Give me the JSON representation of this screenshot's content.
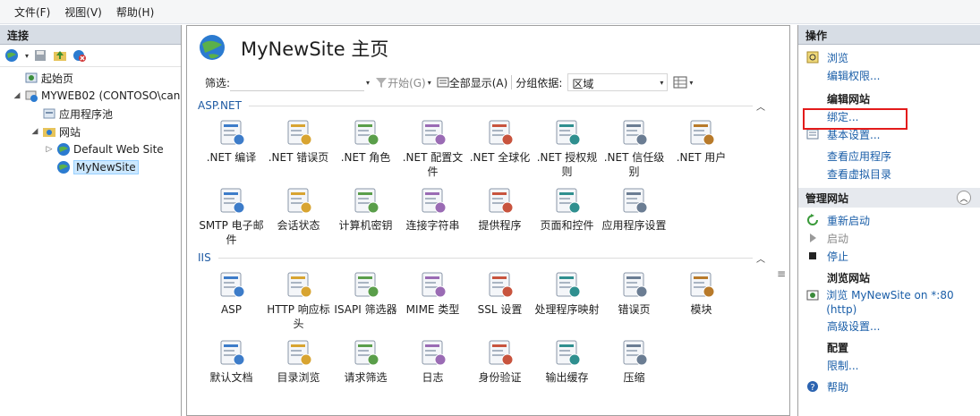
{
  "menu": {
    "file": "文件(F)",
    "view": "视图(V)",
    "help": "帮助(H)"
  },
  "connections": {
    "title": "连接",
    "tree": {
      "start_page": "起始页",
      "server": "MYWEB02 (CONTOSO\\can",
      "app_pools": "应用程序池",
      "sites": "网站",
      "default_site": "Default Web Site",
      "my_site": "MyNewSite"
    }
  },
  "page": {
    "title": "MyNewSite 主页",
    "filter_label": "筛选:",
    "start_label": "开始(G)",
    "show_all": "全部显示(A)",
    "group_by_label": "分组依据:",
    "group_by_value": "区域"
  },
  "groups": {
    "aspnet": {
      "title": "ASP.NET",
      "features": [
        {
          "label": ".NET 编译",
          "icon": "net-compile-icon"
        },
        {
          "label": ".NET 错误页",
          "icon": "net-error-page-icon"
        },
        {
          "label": ".NET 角色",
          "icon": "net-roles-icon"
        },
        {
          "label": ".NET 配置文件",
          "icon": "net-profile-icon"
        },
        {
          "label": ".NET 全球化",
          "icon": "net-globalization-icon"
        },
        {
          "label": ".NET 授权规则",
          "icon": "net-authorization-icon"
        },
        {
          "label": ".NET 信任级别",
          "icon": "net-trust-icon"
        },
        {
          "label": ".NET 用户",
          "icon": "net-users-icon"
        },
        {
          "label": "SMTP 电子邮件",
          "icon": "smtp-email-icon"
        },
        {
          "label": "会话状态",
          "icon": "session-state-icon"
        },
        {
          "label": "计算机密钥",
          "icon": "machine-key-icon"
        },
        {
          "label": "连接字符串",
          "icon": "connection-strings-icon"
        },
        {
          "label": "提供程序",
          "icon": "providers-icon"
        },
        {
          "label": "页面和控件",
          "icon": "pages-controls-icon"
        },
        {
          "label": "应用程序设置",
          "icon": "app-settings-icon"
        }
      ]
    },
    "iis": {
      "title": "IIS",
      "features": [
        {
          "label": "ASP",
          "icon": "asp-icon"
        },
        {
          "label": "HTTP 响应标头",
          "icon": "http-headers-icon"
        },
        {
          "label": "ISAPI 筛选器",
          "icon": "isapi-filters-icon"
        },
        {
          "label": "MIME 类型",
          "icon": "mime-types-icon"
        },
        {
          "label": "SSL 设置",
          "icon": "ssl-settings-icon"
        },
        {
          "label": "处理程序映射",
          "icon": "handler-mappings-icon"
        },
        {
          "label": "错误页",
          "icon": "error-pages-icon"
        },
        {
          "label": "模块",
          "icon": "modules-icon"
        },
        {
          "label": "默认文档",
          "icon": "default-document-icon"
        },
        {
          "label": "目录浏览",
          "icon": "directory-browsing-icon"
        },
        {
          "label": "请求筛选",
          "icon": "request-filtering-icon"
        },
        {
          "label": "日志",
          "icon": "logging-icon"
        },
        {
          "label": "身份验证",
          "icon": "authentication-icon"
        },
        {
          "label": "输出缓存",
          "icon": "output-caching-icon"
        },
        {
          "label": "压缩",
          "icon": "compression-icon"
        }
      ]
    }
  },
  "actions": {
    "title": "操作",
    "browse": "浏览",
    "edit_permissions": "编辑权限...",
    "edit_site_title": "编辑网站",
    "bindings": "绑定...",
    "basic_settings": "基本设置...",
    "view_applications": "查看应用程序",
    "view_virtual_dirs": "查看虚拟目录",
    "manage_site_title": "管理网站",
    "restart": "重新启动",
    "start": "启动",
    "stop": "停止",
    "browse_site_title": "浏览网站",
    "browse_link": "浏览 MyNewSite on *:80 (http)",
    "advanced_settings": "高级设置...",
    "config_title": "配置",
    "limits": "限制...",
    "help": "帮助"
  },
  "colors": {
    "link": "#1a5ea8",
    "group_header": "#1e5aa3",
    "highlight": "#e31b1b"
  }
}
